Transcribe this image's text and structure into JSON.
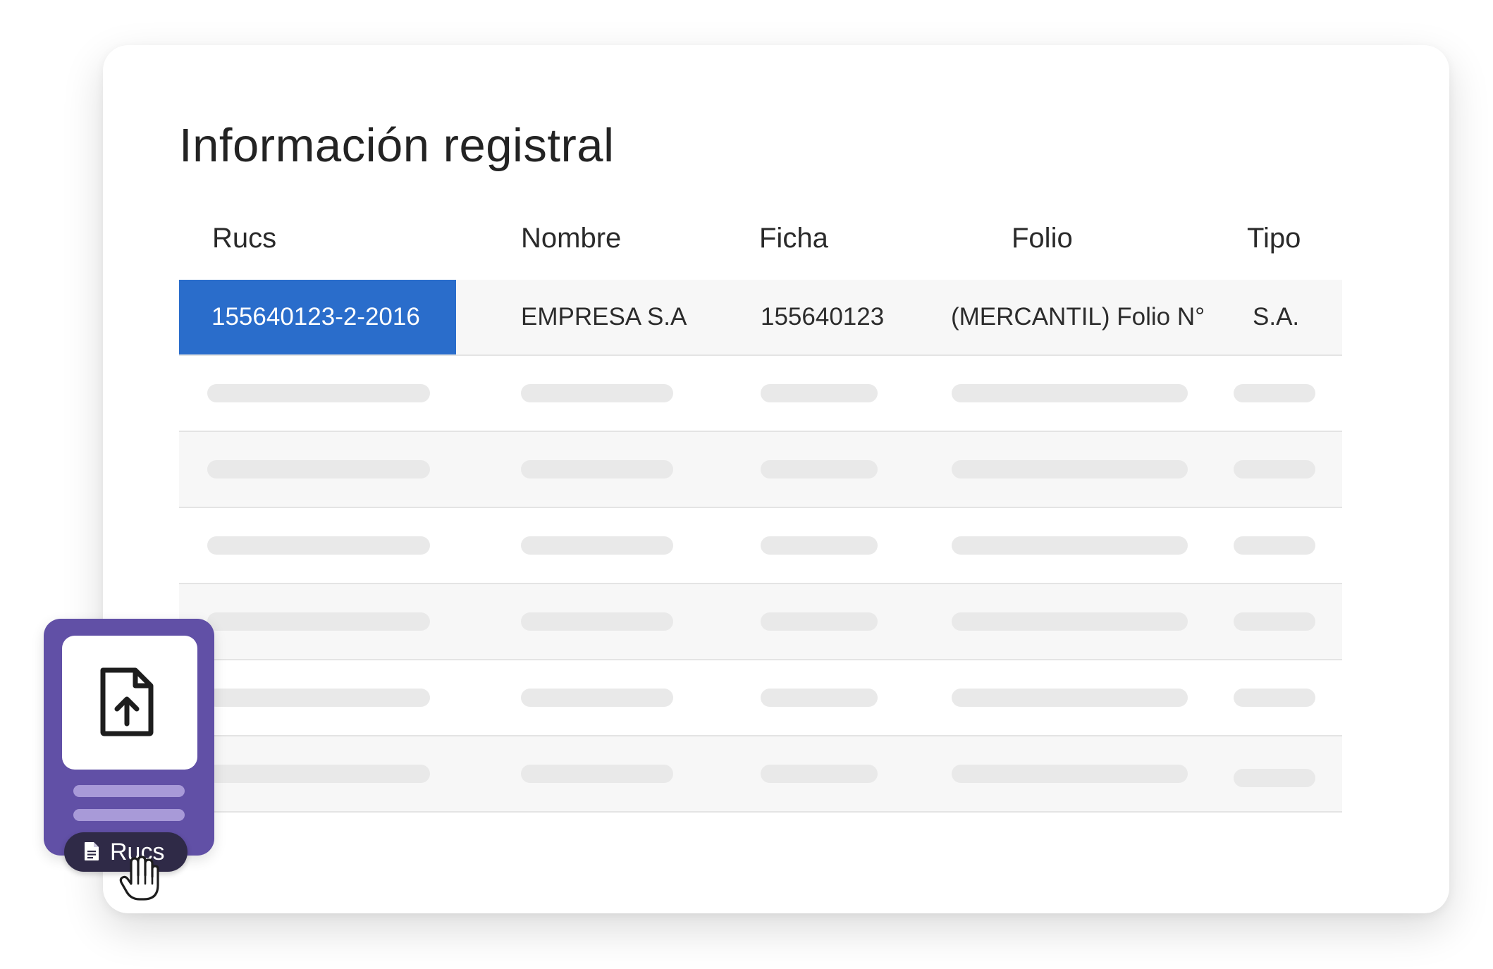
{
  "page": {
    "title": "Información registral"
  },
  "table": {
    "columns": [
      "Rucs",
      "Nombre",
      "Ficha",
      "Folio",
      "Tipo"
    ],
    "rows": [
      {
        "ruc": "155640123-2-2016",
        "nombre": "EMPRESA S.A",
        "ficha": "155640123",
        "folio": "(MERCANTIL) Folio N°",
        "tipo": "S.A.",
        "selected_cell": "ruc"
      }
    ],
    "placeholder_row_count": 6
  },
  "uploader": {
    "icon": "file-upload-icon",
    "button_icon": "document-icon",
    "button_label": "Rucs",
    "cursor_icon": "hand-pointer-icon"
  },
  "colors": {
    "selected_cell": "#2a6dcb",
    "uploader_bg": "#6150a6",
    "chip_bg": "#2f2a47",
    "skeleton": "#e9e9e9",
    "row_shade": "#f7f7f7"
  }
}
